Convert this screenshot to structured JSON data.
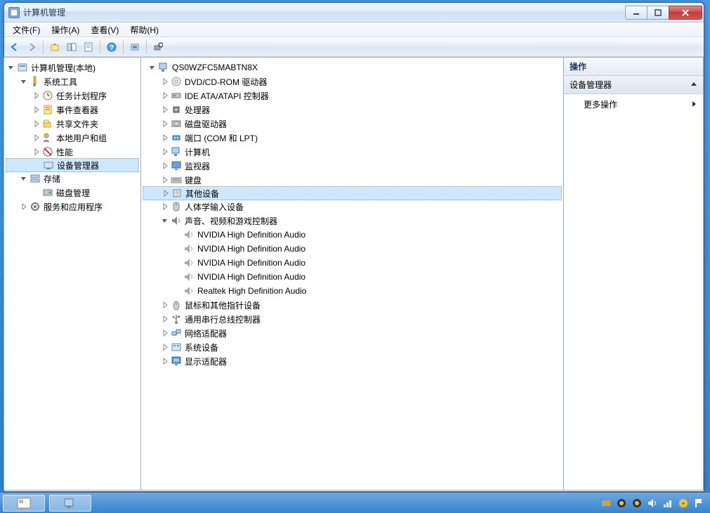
{
  "window": {
    "title": "计算机管理"
  },
  "menu": [
    "文件(F)",
    "操作(A)",
    "查看(V)",
    "帮助(H)"
  ],
  "leftTree": [
    {
      "d": 0,
      "t": "open",
      "ic": "mgmt",
      "lbl": "计算机管理(本地)"
    },
    {
      "d": 1,
      "t": "open",
      "ic": "tools",
      "lbl": "系统工具"
    },
    {
      "d": 2,
      "t": "closed",
      "ic": "sched",
      "lbl": "任务计划程序"
    },
    {
      "d": 2,
      "t": "closed",
      "ic": "event",
      "lbl": "事件查看器"
    },
    {
      "d": 2,
      "t": "closed",
      "ic": "share",
      "lbl": "共享文件夹"
    },
    {
      "d": 2,
      "t": "closed",
      "ic": "users",
      "lbl": "本地用户和组"
    },
    {
      "d": 2,
      "t": "closed",
      "ic": "perf",
      "lbl": "性能"
    },
    {
      "d": 2,
      "t": "none",
      "ic": "devmgr",
      "lbl": "设备管理器",
      "sel": true
    },
    {
      "d": 1,
      "t": "open",
      "ic": "storage",
      "lbl": "存储"
    },
    {
      "d": 2,
      "t": "none",
      "ic": "disk",
      "lbl": "磁盘管理"
    },
    {
      "d": 1,
      "t": "closed",
      "ic": "services",
      "lbl": "服务和应用程序"
    }
  ],
  "midTree": [
    {
      "d": 0,
      "t": "open",
      "ic": "pc",
      "lbl": "QS0WZFC5MABTN8X"
    },
    {
      "d": 1,
      "t": "closed",
      "ic": "dvd",
      "lbl": "DVD/CD-ROM 驱动器"
    },
    {
      "d": 1,
      "t": "closed",
      "ic": "ide",
      "lbl": "IDE ATA/ATAPI 控制器"
    },
    {
      "d": 1,
      "t": "closed",
      "ic": "cpu",
      "lbl": "处理器"
    },
    {
      "d": 1,
      "t": "closed",
      "ic": "hdd",
      "lbl": "磁盘驱动器"
    },
    {
      "d": 1,
      "t": "closed",
      "ic": "port",
      "lbl": "端口 (COM 和 LPT)"
    },
    {
      "d": 1,
      "t": "closed",
      "ic": "pc2",
      "lbl": "计算机"
    },
    {
      "d": 1,
      "t": "closed",
      "ic": "mon",
      "lbl": "监视器"
    },
    {
      "d": 1,
      "t": "closed",
      "ic": "kbd",
      "lbl": "键盘"
    },
    {
      "d": 1,
      "t": "closed",
      "ic": "other",
      "lbl": "其他设备",
      "sel": true
    },
    {
      "d": 1,
      "t": "closed",
      "ic": "hid",
      "lbl": "人体学输入设备"
    },
    {
      "d": 1,
      "t": "open",
      "ic": "snd",
      "lbl": "声音、视频和游戏控制器"
    },
    {
      "d": 2,
      "t": "none",
      "ic": "spk",
      "lbl": "NVIDIA High Definition Audio"
    },
    {
      "d": 2,
      "t": "none",
      "ic": "spk",
      "lbl": "NVIDIA High Definition Audio"
    },
    {
      "d": 2,
      "t": "none",
      "ic": "spk",
      "lbl": "NVIDIA High Definition Audio"
    },
    {
      "d": 2,
      "t": "none",
      "ic": "spk",
      "lbl": "NVIDIA High Definition Audio"
    },
    {
      "d": 2,
      "t": "none",
      "ic": "spk",
      "lbl": "Realtek High Definition Audio"
    },
    {
      "d": 1,
      "t": "closed",
      "ic": "mouse",
      "lbl": "鼠标和其他指针设备"
    },
    {
      "d": 1,
      "t": "closed",
      "ic": "usb",
      "lbl": "通用串行总线控制器"
    },
    {
      "d": 1,
      "t": "closed",
      "ic": "net",
      "lbl": "网络适配器"
    },
    {
      "d": 1,
      "t": "closed",
      "ic": "sys",
      "lbl": "系统设备"
    },
    {
      "d": 1,
      "t": "closed",
      "ic": "disp",
      "lbl": "显示适配器"
    }
  ],
  "rightPanel": {
    "header": "操作",
    "sub": "设备管理器",
    "item": "更多操作"
  }
}
